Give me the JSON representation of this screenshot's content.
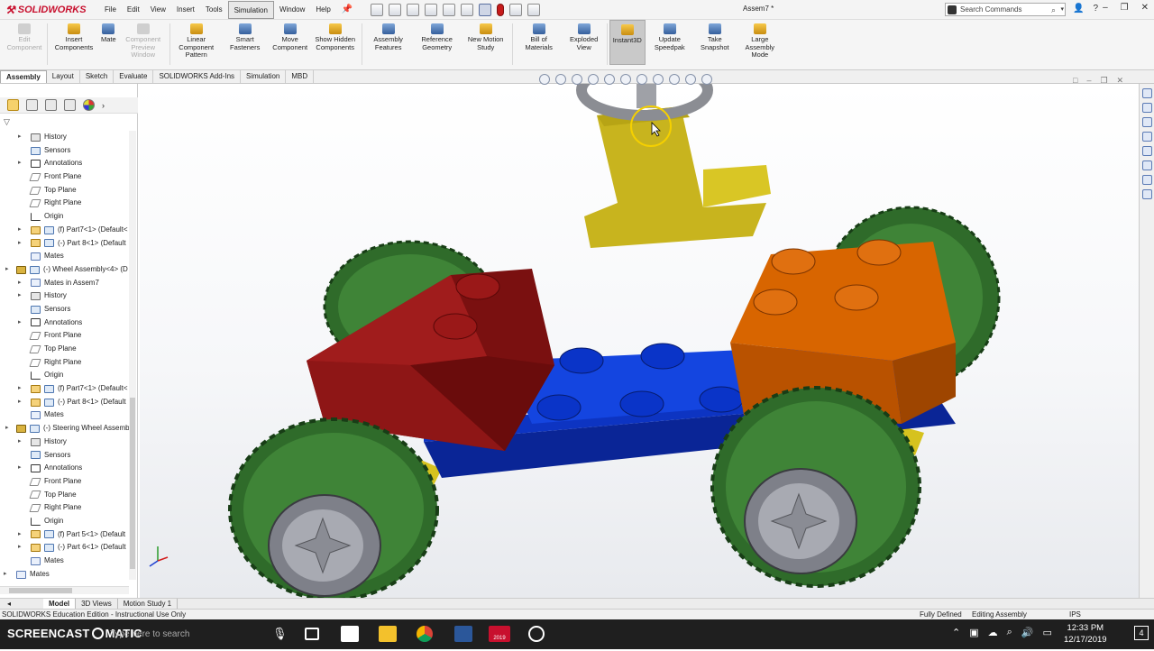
{
  "app": {
    "logo": "SOLIDWORKS",
    "doc_title": "Assem7 *",
    "menus": [
      "File",
      "Edit",
      "View",
      "Insert",
      "Tools",
      "Simulation",
      "Window",
      "Help"
    ],
    "active_menu": "Simulation",
    "search_placeholder": "Search Commands"
  },
  "ribbon": {
    "buttons": [
      {
        "label": "Edit Component",
        "icon": "edit-component-icon",
        "disabled": true
      },
      {
        "label": "Insert Components",
        "icon": "insert-components-icon",
        "disabled": false
      },
      {
        "label": "Mate",
        "icon": "mate-icon",
        "disabled": false
      },
      {
        "label": "Component Preview Window",
        "icon": "component-preview-icon",
        "disabled": true
      },
      {
        "label": "Linear Component Pattern",
        "icon": "pattern-icon",
        "disabled": false
      },
      {
        "label": "Smart Fasteners",
        "icon": "fasteners-icon",
        "disabled": false
      },
      {
        "label": "Move Component",
        "icon": "move-component-icon",
        "disabled": false
      },
      {
        "label": "Show Hidden Components",
        "icon": "show-hidden-icon",
        "disabled": false
      },
      {
        "label": "Assembly Features",
        "icon": "assembly-features-icon",
        "disabled": false
      },
      {
        "label": "Reference Geometry",
        "icon": "reference-geometry-icon",
        "disabled": false
      },
      {
        "label": "New Motion Study",
        "icon": "motion-study-icon",
        "disabled": false
      },
      {
        "label": "Bill of Materials",
        "icon": "bom-icon",
        "disabled": false
      },
      {
        "label": "Exploded View",
        "icon": "exploded-view-icon",
        "disabled": false
      },
      {
        "label": "Instant3D",
        "icon": "instant3d-icon",
        "disabled": false,
        "active": true
      },
      {
        "label": "Update Speedpak",
        "icon": "speedpak-icon",
        "disabled": false
      },
      {
        "label": "Take Snapshot",
        "icon": "snapshot-icon",
        "disabled": false
      },
      {
        "label": "Large Assembly Mode",
        "icon": "large-assembly-icon",
        "disabled": false
      }
    ]
  },
  "command_tabs": [
    "Assembly",
    "Layout",
    "Sketch",
    "Evaluate",
    "SOLIDWORKS Add-Ins",
    "Simulation",
    "MBD"
  ],
  "active_command_tab": "Assembly",
  "tree": [
    {
      "label": "History",
      "icon": "hist",
      "indent": 1,
      "expand": true
    },
    {
      "label": "Sensors",
      "icon": "sens",
      "indent": 1,
      "expand": false
    },
    {
      "label": "Annotations",
      "icon": "ann",
      "indent": 1,
      "expand": true
    },
    {
      "label": "Front Plane",
      "icon": "plane",
      "indent": 1,
      "expand": false
    },
    {
      "label": "Top Plane",
      "icon": "plane",
      "indent": 1,
      "expand": false
    },
    {
      "label": "Right Plane",
      "icon": "plane",
      "indent": 1,
      "expand": false
    },
    {
      "label": "Origin",
      "icon": "orig",
      "indent": 1,
      "expand": false
    },
    {
      "label": "(f) Part7<1> (Default<",
      "icon": "part",
      "indent": 1,
      "expand": true
    },
    {
      "label": "(-) Part 8<1> (Default",
      "icon": "part",
      "indent": 1,
      "expand": true
    },
    {
      "label": "Mates",
      "icon": "mate",
      "indent": 1,
      "expand": false
    },
    {
      "label": "(-) Wheel Assembly<4> (D",
      "icon": "asm",
      "indent": 0,
      "expand": true
    },
    {
      "label": "Mates in Assem7",
      "icon": "mate",
      "indent": 1,
      "expand": true
    },
    {
      "label": "History",
      "icon": "hist",
      "indent": 1,
      "expand": true
    },
    {
      "label": "Sensors",
      "icon": "sens",
      "indent": 1,
      "expand": false
    },
    {
      "label": "Annotations",
      "icon": "ann",
      "indent": 1,
      "expand": true
    },
    {
      "label": "Front Plane",
      "icon": "plane",
      "indent": 1,
      "expand": false
    },
    {
      "label": "Top Plane",
      "icon": "plane",
      "indent": 1,
      "expand": false
    },
    {
      "label": "Right Plane",
      "icon": "plane",
      "indent": 1,
      "expand": false
    },
    {
      "label": "Origin",
      "icon": "orig",
      "indent": 1,
      "expand": false
    },
    {
      "label": "(f) Part7<1> (Default<",
      "icon": "part",
      "indent": 1,
      "expand": true
    },
    {
      "label": "(-) Part 8<1> (Default",
      "icon": "part",
      "indent": 1,
      "expand": true
    },
    {
      "label": "Mates",
      "icon": "mate",
      "indent": 1,
      "expand": false
    },
    {
      "label": "(-) Steering Wheel Assemb",
      "icon": "asm",
      "indent": 0,
      "expand": true
    },
    {
      "label": "History",
      "icon": "hist",
      "indent": 1,
      "expand": true
    },
    {
      "label": "Sensors",
      "icon": "sens",
      "indent": 1,
      "expand": false
    },
    {
      "label": "Annotations",
      "icon": "ann",
      "indent": 1,
      "expand": true
    },
    {
      "label": "Front Plane",
      "icon": "plane",
      "indent": 1,
      "expand": false
    },
    {
      "label": "Top Plane",
      "icon": "plane",
      "indent": 1,
      "expand": false
    },
    {
      "label": "Right Plane",
      "icon": "plane",
      "indent": 1,
      "expand": false
    },
    {
      "label": "Origin",
      "icon": "orig",
      "indent": 1,
      "expand": false
    },
    {
      "label": "(f) Part 5<1> (Default",
      "icon": "part",
      "indent": 1,
      "expand": true
    },
    {
      "label": "(-) Part 6<1> (Default",
      "icon": "part",
      "indent": 1,
      "expand": true
    },
    {
      "label": "Mates",
      "icon": "mate",
      "indent": 1,
      "expand": false
    },
    {
      "label": "Mates",
      "icon": "mate",
      "indent": -1,
      "expand": true
    }
  ],
  "bottom_tabs": [
    "Model",
    "3D Views",
    "Motion Study 1"
  ],
  "status": {
    "edition": "SOLIDWORKS Education Edition - Instructional Use Only",
    "defined": "Fully Defined",
    "mode": "Editing Assembly",
    "units": "IPS"
  },
  "taskbar": {
    "watermark": "SCREENCAST",
    "watermark_suffix": "MATIC",
    "search_placeholder": "Type here to search",
    "time": "12:33 PM",
    "date": "12/17/2019",
    "sw_version": "2019",
    "notification_count": "4"
  },
  "colors": {
    "brand": "#c8102e",
    "tire_green": "#2f6b2a",
    "brick_red": "#8a1010",
    "brick_blue": "#0b2fb0",
    "brick_orange": "#c55a00",
    "steering_yellow": "#c8b41e"
  }
}
